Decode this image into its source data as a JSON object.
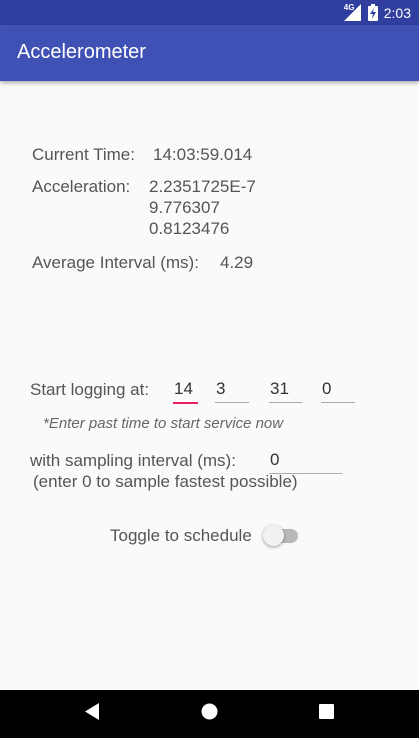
{
  "status_bar": {
    "time": "2:03",
    "network_label": "4G",
    "icons": [
      "signal-icon",
      "battery-icon"
    ]
  },
  "app_bar": {
    "title": "Accelerometer"
  },
  "readings": {
    "current_time_label": "Current Time:",
    "current_time_value": "14:03:59.014",
    "acceleration_label": "Acceleration:",
    "acceleration_x": "2.2351725E-7",
    "acceleration_y": "9.776307",
    "acceleration_z": "0.8123476",
    "average_interval_label": "Average Interval (ms):",
    "average_interval_value": "4.29"
  },
  "schedule": {
    "start_logging_label": "Start logging at:",
    "hour": "14",
    "minute": "3",
    "second": "31",
    "millisecond": "0",
    "past_time_hint": "*Enter past time to start service now",
    "sampling_label": "with sampling interval (ms):",
    "sampling_value": "0",
    "sampling_hint": "(enter 0 to sample fastest possible)",
    "toggle_label": "Toggle to schedule",
    "toggle_on": false
  },
  "nav_bar": {
    "buttons": [
      "back-icon",
      "home-icon",
      "recents-icon"
    ]
  },
  "colors": {
    "status_bar": "#303f9f",
    "app_bar": "#3f51b5",
    "accent": "#e91e63",
    "background": "#fafafa"
  }
}
